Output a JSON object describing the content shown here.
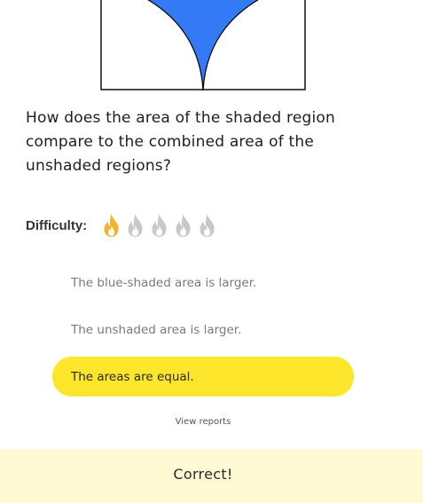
{
  "question": {
    "text": "How does the area of the shaded region compare to the combined area of the unshaded regions?"
  },
  "figure": {
    "fill_color": "#3479f6",
    "stroke_color": "#000000"
  },
  "difficulty": {
    "label": "Difficulty:",
    "level": 1,
    "max": 5,
    "active_color": "#f2b42c",
    "inactive_color": "#c8c8c8"
  },
  "options": [
    {
      "label": "The blue-shaded area is larger.",
      "selected": false
    },
    {
      "label": "The unshaded area is larger.",
      "selected": false
    },
    {
      "label": "The areas are equal.",
      "selected": true
    }
  ],
  "links": {
    "view_reports": "View reports"
  },
  "result": {
    "text": "Correct!",
    "background": "#fff9d4"
  },
  "colors": {
    "selected_option": "#fde62c"
  }
}
